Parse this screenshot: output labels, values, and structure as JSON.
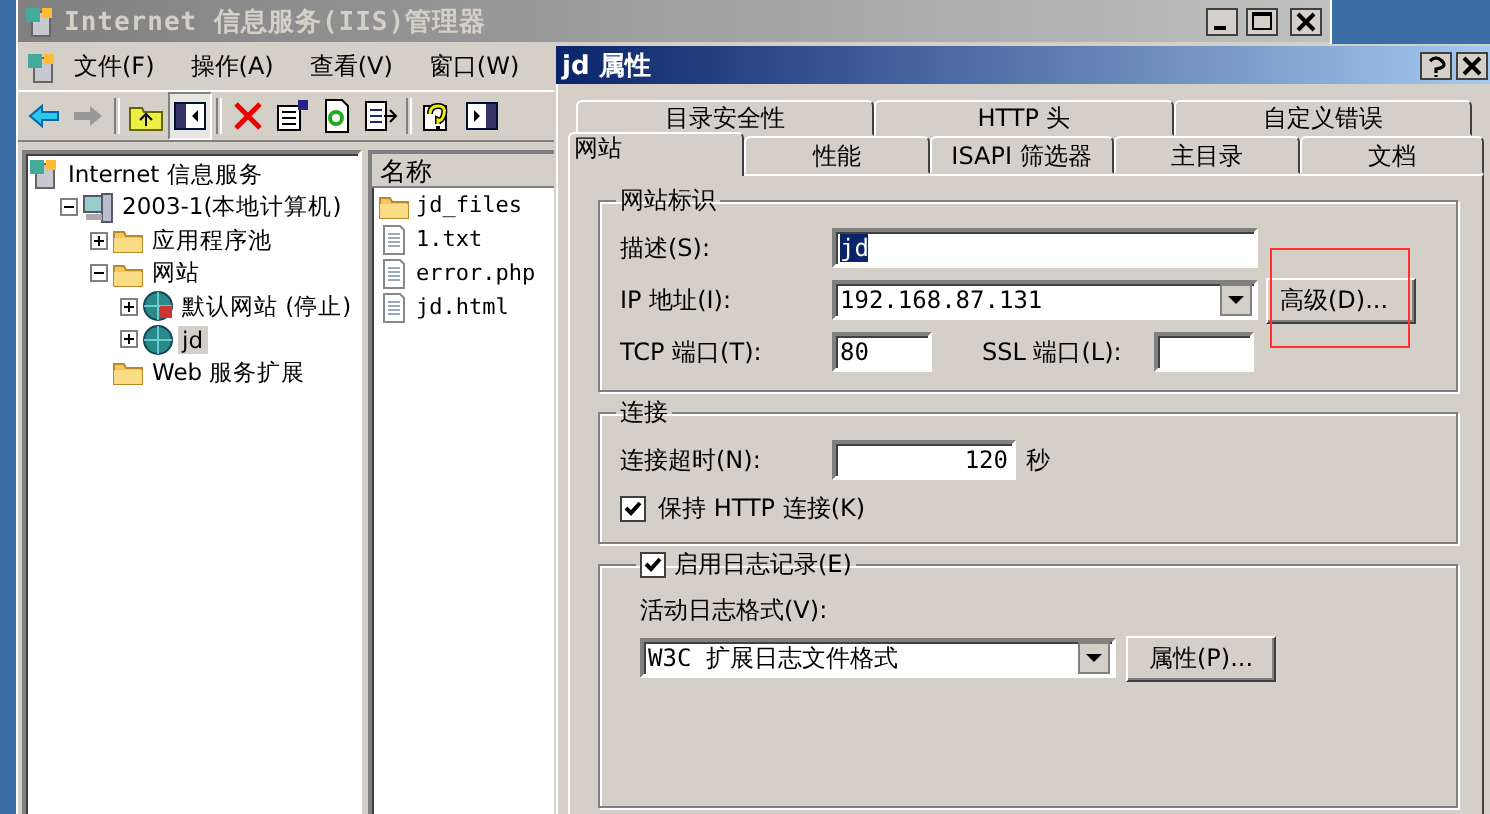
{
  "main_window": {
    "title": "Internet 信息服务(IIS)管理器",
    "active": false,
    "menu": [
      "文件(F)",
      "操作(A)",
      "查看(V)",
      "窗口(W)"
    ],
    "toolbar": [
      {
        "kind": "back"
      },
      {
        "kind": "forward"
      },
      {
        "kind": "separator"
      },
      {
        "kind": "up"
      },
      {
        "kind": "tree",
        "selected": true
      },
      {
        "kind": "separator"
      },
      {
        "kind": "delete"
      },
      {
        "kind": "properties"
      },
      {
        "kind": "refresh"
      },
      {
        "kind": "export"
      },
      {
        "kind": "separator"
      },
      {
        "kind": "help"
      },
      {
        "kind": "pane"
      }
    ],
    "tree": [
      {
        "label": "Internet 信息服务",
        "kind": "service",
        "selected": false,
        "children": [
          {
            "label": "2003-1(本地计算机)",
            "kind": "computer",
            "expanded": true,
            "selected": false,
            "children": [
              {
                "label": "应用程序池",
                "kind": "folder",
                "expanded": false,
                "selected": false
              },
              {
                "label": "网站",
                "kind": "folder",
                "expanded": true,
                "selected": false,
                "children": [
                  {
                    "label": "默认网站 (停止)",
                    "kind": "stopped",
                    "expanded": false,
                    "selected": false
                  },
                  {
                    "label": "jd",
                    "kind": "site",
                    "expanded": false,
                    "selected": true
                  }
                ]
              },
              {
                "label": "Web 服务扩展",
                "kind": "folder",
                "selected": false
              }
            ]
          }
        ]
      }
    ],
    "list": {
      "columns": [
        "名称"
      ],
      "rows": [
        {
          "name": "jd_files",
          "kind": "folder"
        },
        {
          "name": "1.txt",
          "kind": "file"
        },
        {
          "name": "error.php",
          "kind": "file"
        },
        {
          "name": "jd.html",
          "kind": "file"
        }
      ]
    }
  },
  "dialog": {
    "title": "jd 属性",
    "tabs_back": [
      {
        "label": "目录安全性",
        "selected": false
      },
      {
        "label": "HTTP 头",
        "selected": false
      },
      {
        "label": "自定义错误",
        "selected": false
      }
    ],
    "tabs_front": [
      {
        "label": "网站",
        "selected": true
      },
      {
        "label": "性能",
        "selected": false
      },
      {
        "label": "ISAPI 筛选器",
        "selected": false
      },
      {
        "label": "主目录",
        "selected": false
      },
      {
        "label": "文档",
        "selected": false
      }
    ],
    "identity": {
      "legend": "网站标识",
      "description_label": "描述(S):",
      "description": "jd",
      "description_selected": true,
      "ip_label": "IP 地址(I):",
      "ip": "192.168.87.131",
      "tcp_label": "TCP 端口(T):",
      "tcp": "80",
      "ssl_label": "SSL 端口(L):",
      "advanced": "高级(D)...",
      "advanced_highlighted": true
    },
    "connection": {
      "legend": "连接",
      "timeout_label": "连接超时(N):",
      "timeout": "120",
      "unit": "秒",
      "keep_alive": {
        "label": "保持 HTTP 连接(K)",
        "checked": true
      }
    },
    "logging": {
      "label": "启用日志记录(E)",
      "checked": true,
      "format_label": "活动日志格式(V):",
      "format": "W3C 扩展日志文件格式",
      "properties": "属性(P)..."
    }
  }
}
